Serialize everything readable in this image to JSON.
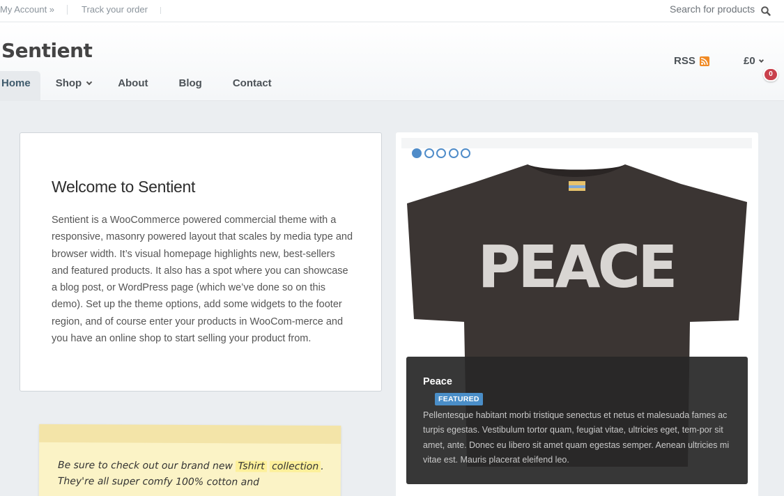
{
  "topbar": {
    "my_account": "My Account »",
    "track_order": "Track your order",
    "search_placeholder": "Search for products"
  },
  "header": {
    "logo": "Sentient",
    "nav": {
      "home": "Home",
      "shop": "Shop",
      "about": "About",
      "blog": "Blog",
      "contact": "Contact"
    },
    "rss": "RSS",
    "cart_total": "£0",
    "cart_count": "0"
  },
  "welcome": {
    "title": "Welcome to Sentient",
    "body": "Sentient is a WooCommerce powered commercial theme with a responsive, masonry powered layout that scales by media type and browser width. It’s visual homepage highlights new, best-sellers and featured products. It also has a spot where you can showcase a blog post, or WordPress page (which we’ve done so on this demo). Set up the theme options, add some widgets to the footer region, and of course enter your products in WooCom-merce and you have an online shop to start selling your product from."
  },
  "note": {
    "prefix": "Be sure to check out our brand new",
    "highlight1": "Tshirt",
    "highlight2": "collection",
    "suffix": ". They're all super comfy 100% cotton and"
  },
  "slider": {
    "slide_count": 5,
    "active_slide": 1,
    "product_name": "Peace",
    "badge": "FEATURED",
    "shirt_print": "PEACE",
    "description": "Pellentesque habitant morbi tristique senectus et netus et malesuada fames ac turpis egestas. Vestibulum tortor quam, feugiat vitae, ultricies eget, tem-por sit amet, ante. Donec eu libero sit amet quam egestas semper. Aenean ultricies mi vitae est. Mauris placerat eleifend leo."
  },
  "colors": {
    "accent": "#4f8cc9",
    "badge_red": "#c9404c",
    "rss_orange": "#f08a24"
  },
  "icons": {
    "search": "search-icon",
    "rss": "rss-icon",
    "chevron": "chevron-down-icon"
  }
}
